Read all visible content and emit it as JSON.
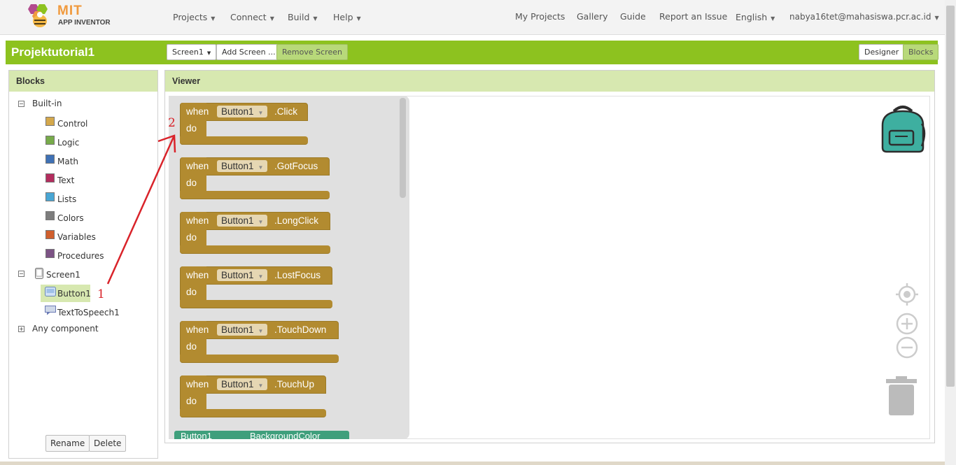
{
  "logo": {
    "mit": "MIT",
    "app": "APP INVENTOR"
  },
  "nav_left": [
    "Projects",
    "Connect",
    "Build",
    "Help"
  ],
  "nav_right": {
    "my_projects": "My Projects",
    "gallery": "Gallery",
    "guide": "Guide",
    "report": "Report an Issue",
    "language": "English",
    "user": "nabya16tet@mahasiswa.pcr.ac.id"
  },
  "project": {
    "title": "Projektutorial1",
    "screen_select": "Screen1",
    "add_screen": "Add Screen ...",
    "remove_screen": "Remove Screen",
    "designer": "Designer",
    "blocks": "Blocks"
  },
  "blocks_panel": {
    "title": "Blocks",
    "builtin_label": "Built-in",
    "builtin": [
      {
        "label": "Control",
        "color": "#d4a84b"
      },
      {
        "label": "Logic",
        "color": "#77ab4a"
      },
      {
        "label": "Math",
        "color": "#3f71b5"
      },
      {
        "label": "Text",
        "color": "#b32d5e"
      },
      {
        "label": "Lists",
        "color": "#49a6d4"
      },
      {
        "label": "Colors",
        "color": "#7d7d7d"
      },
      {
        "label": "Variables",
        "color": "#d05f2d"
      },
      {
        "label": "Procedures",
        "color": "#7c5385"
      }
    ],
    "screen1": "Screen1",
    "components": [
      "Button1",
      "TextToSpeech1"
    ],
    "any_component": "Any component",
    "rename": "Rename",
    "delete": "Delete"
  },
  "viewer": {
    "title": "Viewer"
  },
  "event_blocks": [
    {
      "when": "when",
      "component": "Button1",
      "event": ".Click",
      "do": "do"
    },
    {
      "when": "when",
      "component": "Button1",
      "event": ".GotFocus",
      "do": "do"
    },
    {
      "when": "when",
      "component": "Button1",
      "event": ".LongClick",
      "do": "do"
    },
    {
      "when": "when",
      "component": "Button1",
      "event": ".LostFocus",
      "do": "do"
    },
    {
      "when": "when",
      "component": "Button1",
      "event": ".TouchDown",
      "do": "do"
    },
    {
      "when": "when",
      "component": "Button1",
      "event": ".TouchUp",
      "do": "do"
    }
  ],
  "property_block": {
    "component": "Button1",
    "property": "BackgroundColor"
  },
  "annotations": {
    "one": "1",
    "two": "2"
  },
  "colors": {
    "accent_green": "#8dc21f",
    "event_block": "#b28b30",
    "property_block": "#3f9f7c",
    "annotation": "#d9232a"
  }
}
